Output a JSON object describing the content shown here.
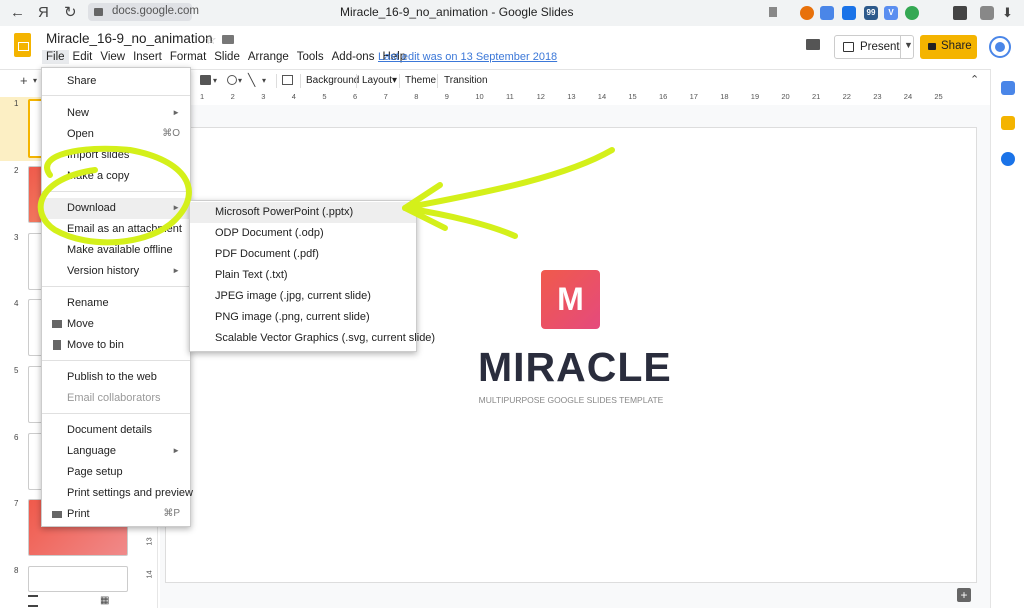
{
  "browser": {
    "url": "docs.google.com",
    "title": "Miracle_16-9_no_animation - Google Slides",
    "back_glyph": "←",
    "yandex_glyph": "Я",
    "reload_glyph": "↻",
    "ext_badges": [
      "99",
      "V"
    ]
  },
  "doc": {
    "filename": "Miracle_16-9_no_animation",
    "last_edit": "Last edit was on 13 September 2018",
    "menus": [
      "File",
      "Edit",
      "View",
      "Insert",
      "Format",
      "Slide",
      "Arrange",
      "Tools",
      "Add-ons",
      "Help"
    ],
    "present_label": "Present",
    "share_label": "Share"
  },
  "toolbar": {
    "add_glyph": "+",
    "background_label": "Background",
    "layout_label": "Layout▾",
    "theme_label": "Theme",
    "transition_label": "Transition",
    "collapse_glyph": "⌃"
  },
  "ruler": {
    "numbers": [
      "1",
      "2",
      "3",
      "4",
      "5",
      "6",
      "7",
      "8",
      "9",
      "10",
      "11",
      "12",
      "13",
      "14",
      "15",
      "16",
      "17",
      "18",
      "19",
      "20",
      "21",
      "22",
      "23",
      "24",
      "25"
    ],
    "vertical_numbers": [
      "13",
      "14"
    ]
  },
  "filmstrip": {
    "numbers": [
      "1",
      "2",
      "3",
      "4",
      "5",
      "6",
      "7",
      "8"
    ]
  },
  "slide": {
    "logo_letter": "M",
    "title": "MIRACLE",
    "subtitle": "MULTIPURPOSE GOOGLE SLIDES TEMPLATE"
  },
  "file_menu": {
    "items": [
      {
        "label": "Share"
      },
      {
        "label": "New"
      },
      {
        "label": "Open",
        "shortcut": "⌘O"
      },
      {
        "label": "Import slides"
      },
      {
        "label": "Make a copy"
      },
      {
        "label": "Download"
      },
      {
        "label": "Email as an attachment"
      },
      {
        "label": "Make available offline"
      },
      {
        "label": "Version history"
      },
      {
        "label": "Rename"
      },
      {
        "label": "Move"
      },
      {
        "label": "Move to bin"
      },
      {
        "label": "Publish to the web"
      },
      {
        "label": "Email collaborators"
      },
      {
        "label": "Document details"
      },
      {
        "label": "Language"
      },
      {
        "label": "Page setup"
      },
      {
        "label": "Print settings and preview"
      },
      {
        "label": "Print",
        "shortcut": "⌘P"
      }
    ]
  },
  "download_submenu": {
    "items": [
      "Microsoft PowerPoint (.pptx)",
      "ODP Document (.odp)",
      "PDF Document (.pdf)",
      "Plain Text (.txt)",
      "JPEG image (.jpg, current slide)",
      "PNG image (.png, current slide)",
      "Scalable Vector Graphics (.svg, current slide)"
    ]
  },
  "colors": {
    "share": "#f4b400",
    "annotation": "#d4f01a",
    "slide_logo_start": "#f05a4b",
    "slide_logo_end": "#e54a7d",
    "link": "#3c78d8"
  }
}
